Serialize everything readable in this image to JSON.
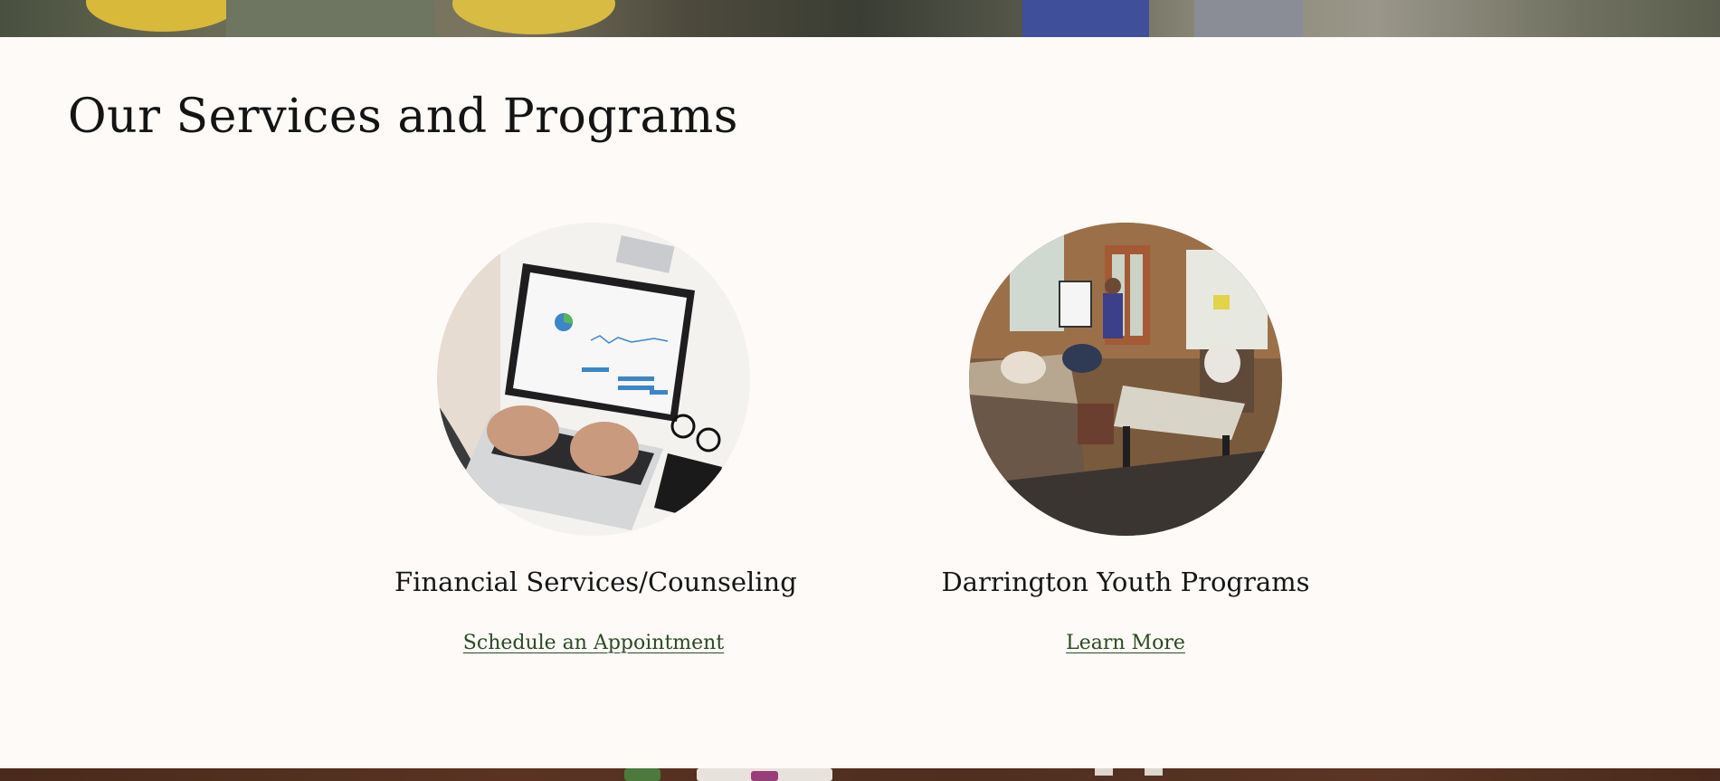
{
  "section": {
    "title": "Our Services and Programs"
  },
  "cards": [
    {
      "title": "Financial Services/Counseling",
      "link_label": "Schedule an Appointment",
      "image_icon": "laptop-photo"
    },
    {
      "title": "Darrington Youth Programs",
      "link_label": "Learn More",
      "image_icon": "youth-lounge-photo"
    }
  ],
  "colors": {
    "background": "#fdfaf7",
    "heading": "#141414",
    "link": "#2b4a22",
    "bottom_banner": "#4f2e20"
  }
}
